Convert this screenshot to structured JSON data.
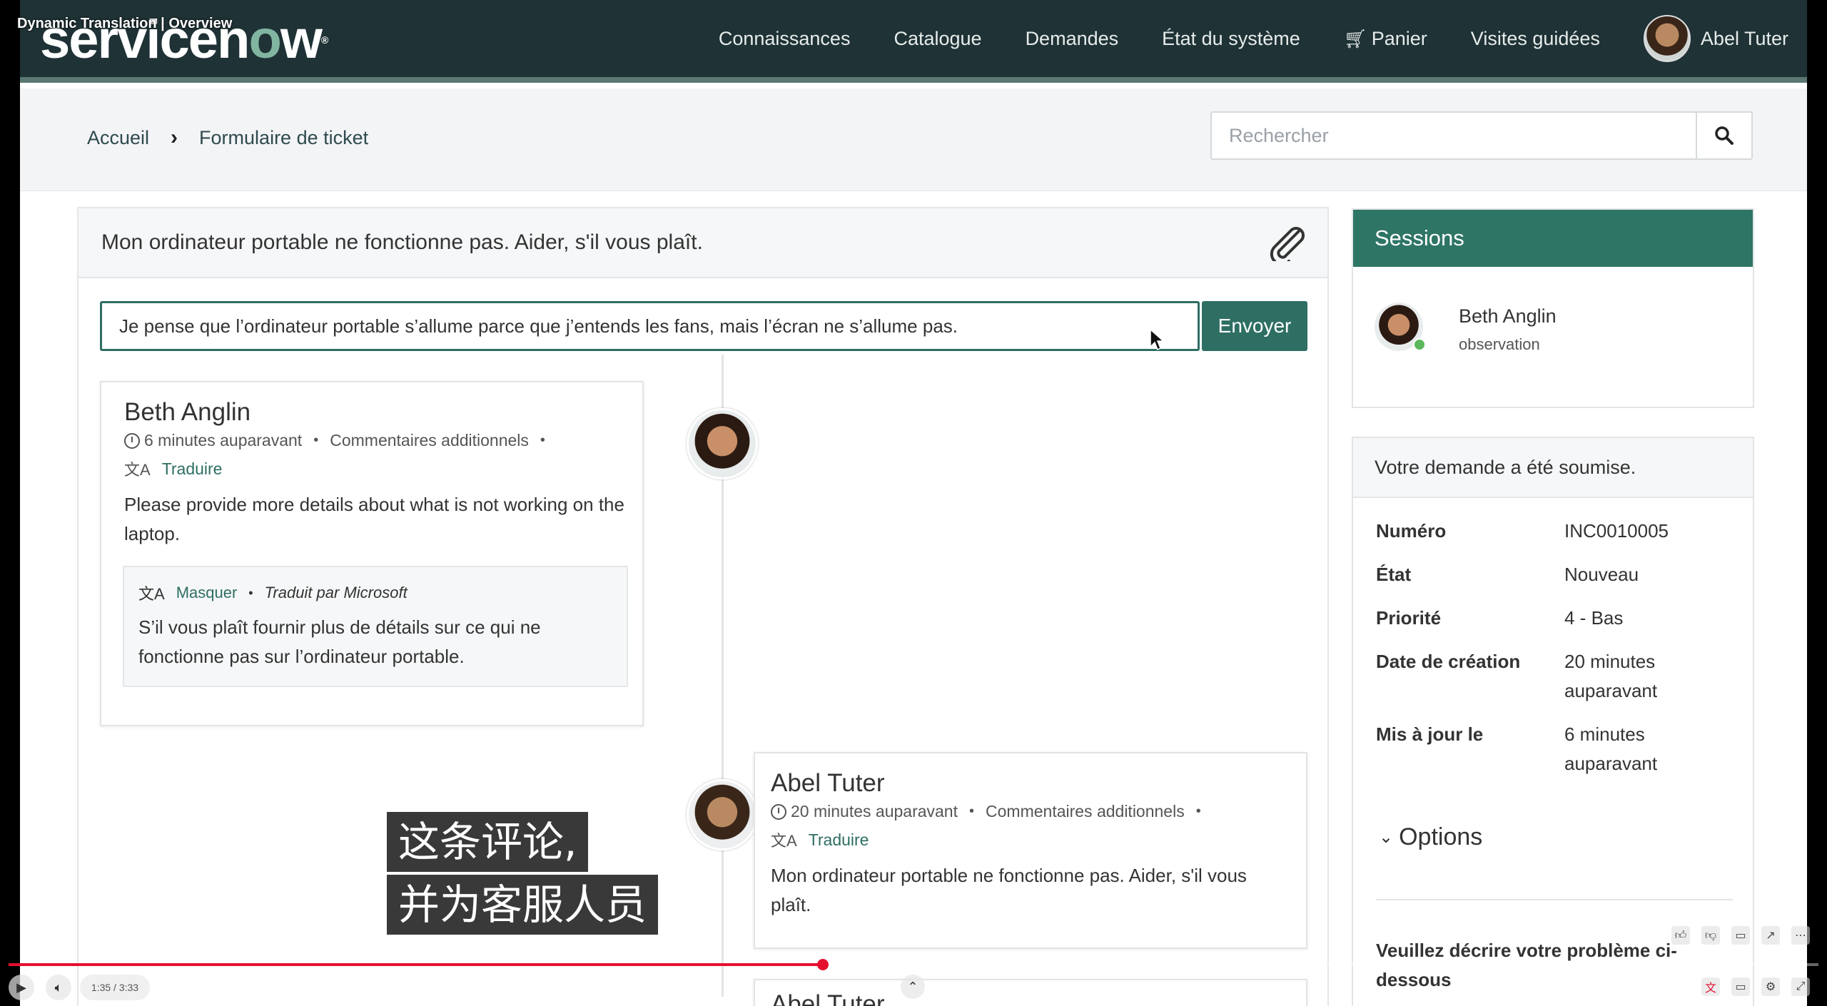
{
  "video": {
    "title": "Dynamic Translation | Overview",
    "time_current": "1:35",
    "time_total": "3:33",
    "progress_pct": 45
  },
  "header": {
    "logo_pre": "servicen",
    "logo_o": "o",
    "logo_post": "w",
    "logo_tm": "®",
    "nav": [
      "Connaissances",
      "Catalogue",
      "Demandes",
      "État du système",
      "Panier",
      "Visites guidées"
    ],
    "user": "Abel Tuter"
  },
  "breadcrumb": {
    "home": "Accueil",
    "current": "Formulaire de ticket"
  },
  "search": {
    "placeholder": "Rechercher",
    "value": ""
  },
  "ticket": {
    "title": "Mon ordinateur portable ne fonctionne pas. Aider, s'il vous plaît.",
    "composer_value": "Je pense que l’ordinateur portable s’allume parce que j’entends les fans, mais l’écran ne s’allume pas.",
    "send_label": "Envoyer"
  },
  "comments": [
    {
      "author": "Beth Anglin",
      "time": "6 minutes auparavant",
      "type": "Commentaires additionnels",
      "translate": "Traduire",
      "body": "Please provide more details about what is not working on the laptop.",
      "hide_label": "Masquer",
      "translated_by": "Traduit par Microsoft",
      "translation": "S’il vous plaît fournir plus de détails sur ce qui ne fonctionne pas sur l’ordinateur portable."
    },
    {
      "author": "Abel Tuter",
      "time": "20 minutes auparavant",
      "type": "Commentaires additionnels",
      "translate": "Traduire",
      "body": "Mon ordinateur portable ne fonctionne pas. Aider, s'il vous plaît.",
      "next_author": "Abel Tuter"
    }
  ],
  "sessions": {
    "title": "Sessions",
    "name": "Beth Anglin",
    "role": "observation"
  },
  "info": {
    "header": "Votre demande a été soumise.",
    "rows": [
      {
        "k": "Numéro",
        "v": "INC0010005"
      },
      {
        "k": "État",
        "v": "Nouveau"
      },
      {
        "k": "Priorité",
        "v": "4 - Bas"
      },
      {
        "k": "Date de création",
        "v": "20 minutes auparavant"
      },
      {
        "k": "Mis à jour le",
        "v": "6 minutes auparavant"
      }
    ],
    "options": "Options",
    "describe": "Veuillez décrire votre problème ci-dessous"
  },
  "subtitle": {
    "line1": "这条评论,",
    "line2": "并为客服人员"
  },
  "colors": {
    "header": "#1f3236",
    "accent": "#2e6e63",
    "sessions": "#2e7566",
    "progress": "#e5102f"
  }
}
